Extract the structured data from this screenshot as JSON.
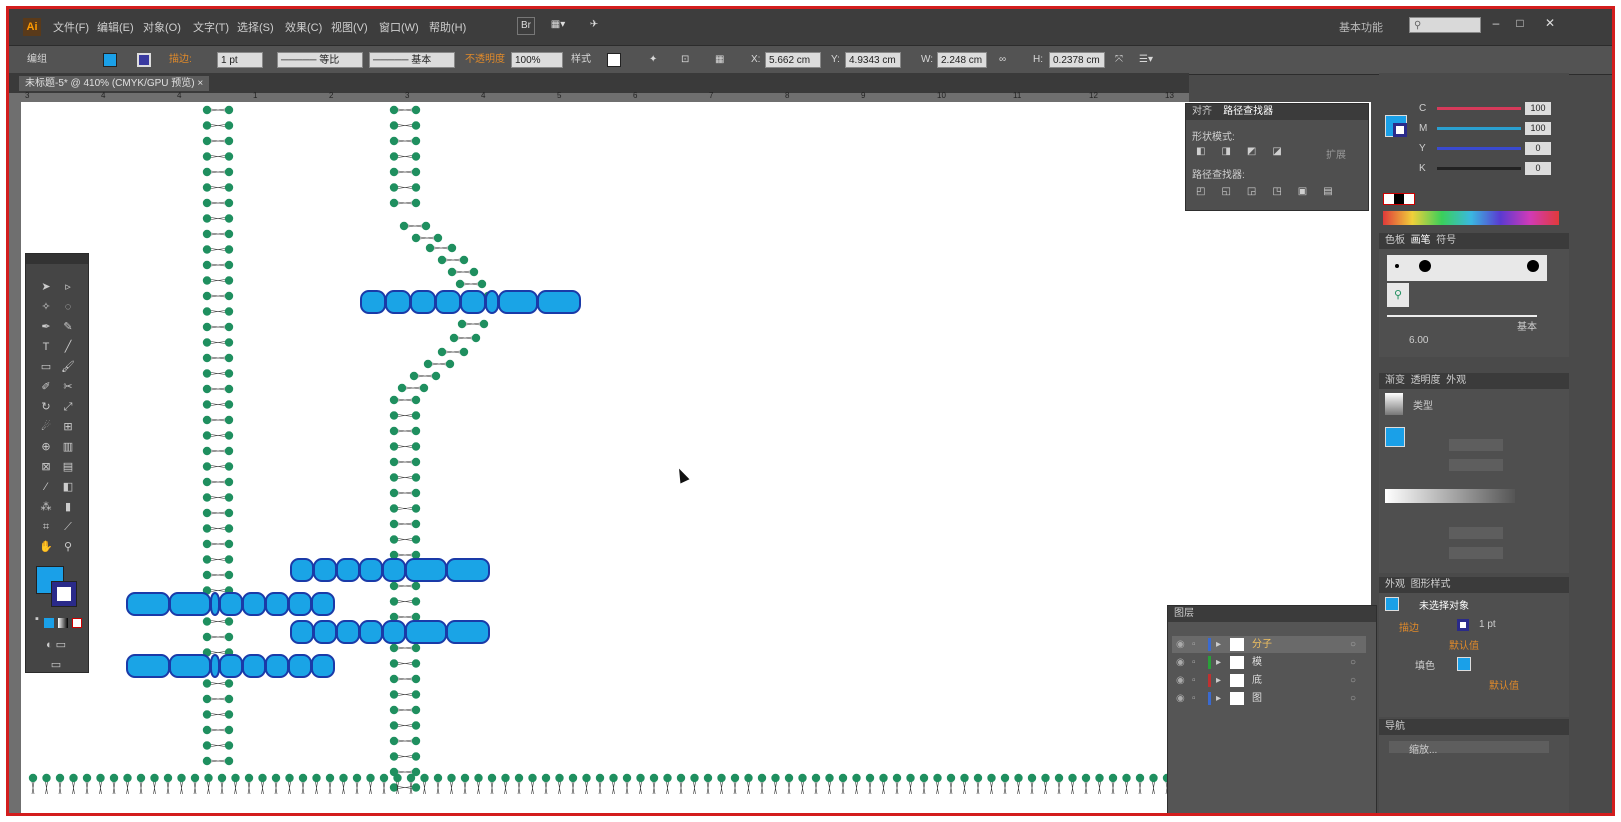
{
  "app": {
    "logo": "Ai"
  },
  "menus": [
    "文件(F)",
    "编辑(E)",
    "对象(O)",
    "文字(T)",
    "选择(S)",
    "效果(C)",
    "视图(V)",
    "窗口(W)",
    "帮助(H)"
  ],
  "menu_buttons": [
    "Br",
    "▦▾",
    "✈"
  ],
  "workspace_label": "基本功能",
  "search_placeholder": "",
  "window_buttons": [
    "–",
    "□",
    "✕"
  ],
  "control_bar": {
    "selection_label": "编组",
    "stroke_weight": "1 pt",
    "stroke_profile": "等比",
    "brush": "基本",
    "opacity_label": "不透明度",
    "opacity_value": "100%",
    "style_label": "样式",
    "x_value": "5.662 cm",
    "y_value": "4.9343 cm",
    "w_value": "2.248 cm",
    "h_value": "0.2378 cm"
  },
  "doc_tab": {
    "title": "未标题-5* @ 410% (CMYK/GPU 预览)",
    "close": "×"
  },
  "ruler_ticks": [
    "3",
    "4",
    "4",
    "1",
    "2",
    "3",
    "4",
    "5",
    "6",
    "7",
    "8",
    "9",
    "10",
    "11",
    "12",
    "13"
  ],
  "pathfinder_panel": {
    "tabs": [
      "对齐",
      "路径查找器"
    ],
    "shape_mode_label": "形状模式:",
    "expand_label": "扩展",
    "pathfinder_label": "路径查找器:"
  },
  "color_panel": {
    "channels": [
      {
        "label": "C",
        "value": "100",
        "color": "#d63a5a"
      },
      {
        "label": "M",
        "value": "100",
        "color": "#2aa0d0"
      },
      {
        "label": "Y",
        "value": "0",
        "color": "#3a4ad0"
      },
      {
        "label": "K",
        "value": "0",
        "color": "#222222"
      }
    ]
  },
  "brushes_panel": {
    "tabs": [
      "色板",
      "画笔",
      "符号"
    ],
    "basic_label": "基本",
    "size_label": "6.00"
  },
  "gradient_panel": {
    "tabs": [
      "渐变",
      "透明度",
      "外观"
    ],
    "type_label": "类型"
  },
  "appearance_panel": {
    "tabs": [
      "外观",
      "图形样式"
    ],
    "title": "未选择对象",
    "stroke_label": "描边",
    "stroke_value": "1 pt",
    "opacity_default": "默认值",
    "fill_label": "填色",
    "fill_opacity": "默认值"
  },
  "layers_panel": {
    "title": "图层",
    "layers": [
      {
        "name": "分子",
        "color": "#3a6ad0"
      },
      {
        "name": "模",
        "color": "#2aa03a"
      },
      {
        "name": "底",
        "color": "#c03030"
      },
      {
        "name": "图",
        "color": "#3a6ad0"
      }
    ]
  },
  "bottom_panel": {
    "tab": "导航",
    "field": "缩放..."
  },
  "colors": {
    "accent": "#1aa0e8",
    "protein": "#1aa4e6",
    "protein_border": "#1a3aa8",
    "lipid": "#1f8f5f"
  },
  "icons": [
    "selection-tool-icon",
    "direct-selection-icon",
    "pen-tool-icon",
    "type-tool-icon",
    "line-tool-icon",
    "rectangle-tool-icon",
    "brush-tool-icon",
    "rotate-tool-icon",
    "scale-tool-icon",
    "hand-tool-icon",
    "zoom-tool-icon",
    "fill-swatch-icon",
    "stroke-swatch-icon"
  ]
}
